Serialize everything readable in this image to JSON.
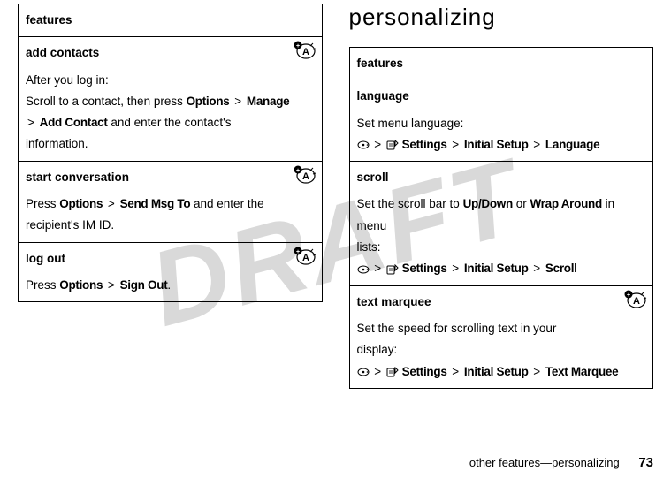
{
  "left": {
    "header": "features",
    "rows": [
      {
        "title": "add contacts",
        "icon": true,
        "lines": [
          {
            "plain": "After you log in:"
          },
          {
            "segments": [
              {
                "t": "Scroll to a contact, then press ",
                "k": "plain"
              },
              {
                "t": "Options",
                "k": "cond"
              },
              {
                "t": " > ",
                "k": "sep"
              },
              {
                "t": "Manage",
                "k": "cond"
              }
            ]
          },
          {
            "segments": [
              {
                "t": "> ",
                "k": "sep"
              },
              {
                "t": "Add Contact",
                "k": "cond"
              },
              {
                "t": " and enter the contact's information.",
                "k": "plain"
              }
            ]
          }
        ]
      },
      {
        "title": "start conversation",
        "icon": true,
        "lines": [
          {
            "segments": [
              {
                "t": "Press ",
                "k": "plain"
              },
              {
                "t": "Options",
                "k": "cond"
              },
              {
                "t": " > ",
                "k": "sep"
              },
              {
                "t": "Send Msg To",
                "k": "cond"
              },
              {
                "t": " and enter the ",
                "k": "plain"
              }
            ]
          },
          {
            "plain": "recipient's IM ID."
          }
        ]
      },
      {
        "title": "log out",
        "icon": true,
        "lines": [
          {
            "segments": [
              {
                "t": "Press ",
                "k": "plain"
              },
              {
                "t": "Options",
                "k": "cond"
              },
              {
                "t": " > ",
                "k": "sep"
              },
              {
                "t": "Sign Out",
                "k": "cond"
              },
              {
                "t": ".",
                "k": "plain"
              }
            ]
          }
        ]
      }
    ]
  },
  "right": {
    "section_title": "personalizing",
    "header": "features",
    "rows": [
      {
        "title": "language",
        "icon": false,
        "lines": [
          {
            "plain": "Set menu language:"
          },
          {
            "nav": true,
            "segments": [
              {
                "t": "Settings",
                "k": "cond"
              },
              {
                "t": " > ",
                "k": "sep"
              },
              {
                "t": "Initial Setup",
                "k": "cond"
              },
              {
                "t": " > ",
                "k": "sep"
              },
              {
                "t": "Language",
                "k": "cond"
              }
            ]
          }
        ]
      },
      {
        "title": "scroll",
        "icon": false,
        "lines": [
          {
            "segments": [
              {
                "t": "Set the scroll bar to ",
                "k": "plain"
              },
              {
                "t": "Up/Down",
                "k": "cond"
              },
              {
                "t": " or ",
                "k": "plain"
              },
              {
                "t": "Wrap Around",
                "k": "cond"
              },
              {
                "t": " in menu ",
                "k": "plain"
              }
            ]
          },
          {
            "plain": "lists:"
          },
          {
            "nav": true,
            "segments": [
              {
                "t": "Settings",
                "k": "cond"
              },
              {
                "t": " > ",
                "k": "sep"
              },
              {
                "t": "Initial Setup",
                "k": "cond"
              },
              {
                "t": " > ",
                "k": "sep"
              },
              {
                "t": "Scroll",
                "k": "cond"
              }
            ]
          }
        ]
      },
      {
        "title": "text marquee",
        "icon": true,
        "lines": [
          {
            "plain": "Set the speed for scrolling text in your"
          },
          {
            "plain": "display:"
          },
          {
            "nav": true,
            "segments": [
              {
                "t": "Settings",
                "k": "cond"
              },
              {
                "t": " > ",
                "k": "sep"
              },
              {
                "t": "Initial Setup",
                "k": "cond"
              },
              {
                "t": " > ",
                "k": "sep"
              },
              {
                "t": "Text Marquee",
                "k": "cond"
              }
            ]
          }
        ]
      }
    ]
  },
  "footer": {
    "text": "other features—personalizing",
    "page": "73"
  },
  "watermark": "DRAFT"
}
